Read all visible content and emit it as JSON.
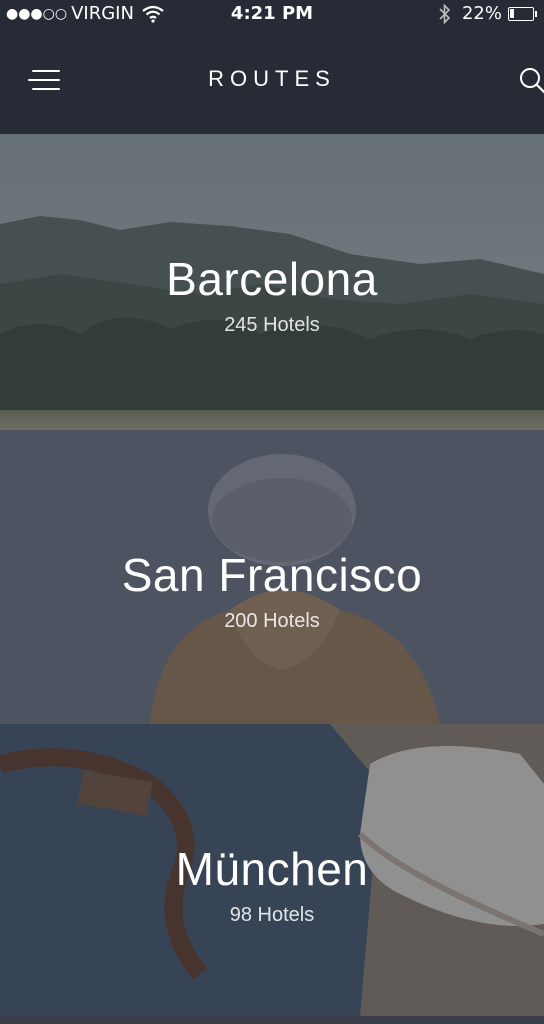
{
  "status_bar": {
    "signal_dots": "●●●○○",
    "carrier": "VIRGIN",
    "time": "4:21 PM",
    "battery_percent": "22%",
    "battery_level": 0.22,
    "icons": [
      "wifi-icon",
      "bluetooth-icon",
      "battery-icon"
    ]
  },
  "nav": {
    "title": "ROUTES",
    "menu_icon": "hamburger-menu-icon",
    "search_icon": "search-icon"
  },
  "routes": [
    {
      "city": "Barcelona",
      "hotels": "245 Hotels",
      "theme": "misty-forest"
    },
    {
      "city": "San Francisco",
      "hotels": "200 Hotels",
      "theme": "person-in-beanie"
    },
    {
      "city": "München",
      "hotels": "98 Hotels",
      "theme": "denim-and-sneakers"
    }
  ],
  "colors": {
    "nav_background": "#262b36",
    "overlay": "#3a4050"
  }
}
